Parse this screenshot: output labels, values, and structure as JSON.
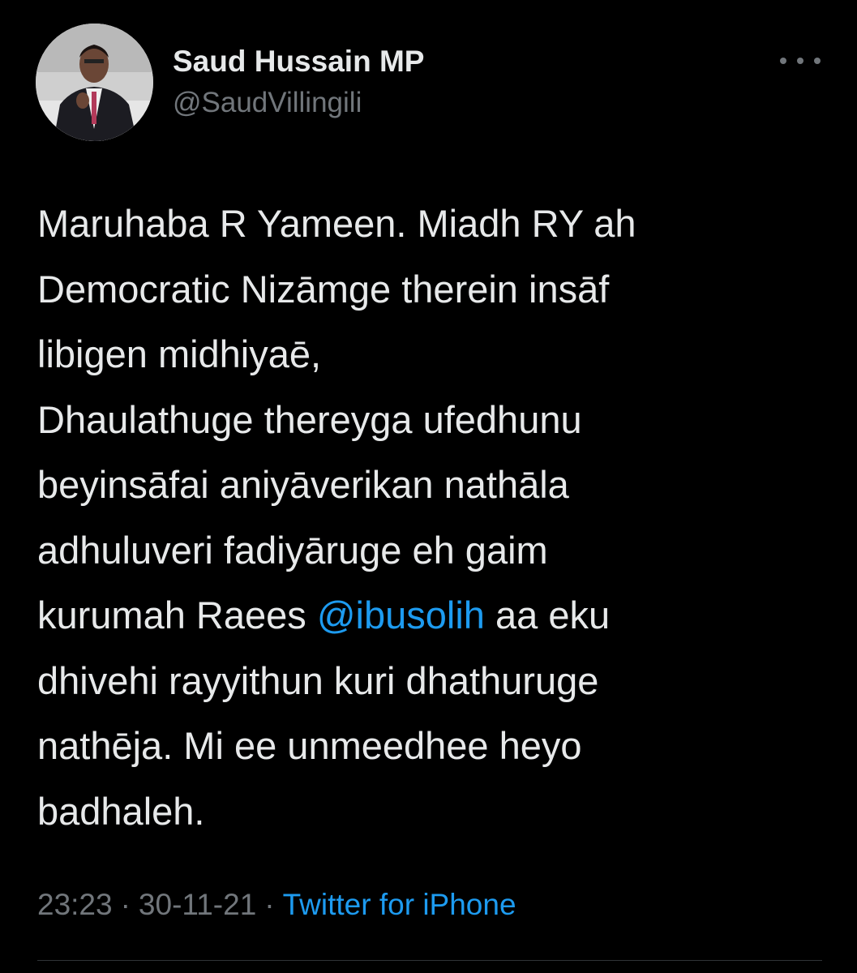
{
  "author": {
    "name": "Saud Hussain MP",
    "handle": "@SaudVillingili"
  },
  "tweet": {
    "lines": [
      {
        "text": "Maruhaba R Yameen. Miadh RY ah"
      },
      {
        "text": "Democratic Nizāmge therein insāf"
      },
      {
        "text": "libigen midhiyaē,"
      },
      {
        "text": "Dhaulathuge thereyga ufedhunu"
      },
      {
        "text": "beyinsāfai aniyāverikan nathāla"
      },
      {
        "text": "adhuluveri fadiyāruge eh gaim"
      },
      {
        "before": "kurumah Raees ",
        "mention": "@ibusolih",
        "after": " aa eku"
      },
      {
        "text": "dhivehi rayyithun kuri dhathuruge"
      },
      {
        "text": "nathēja. Mi ee unmeedhee heyo"
      },
      {
        "text": "badhaleh."
      }
    ]
  },
  "meta": {
    "time": "23:23",
    "separator": "·",
    "date": "30-11-21",
    "source": "Twitter for iPhone"
  },
  "icons": {
    "more": "more-horizontal-icon"
  },
  "colors": {
    "background": "#000000",
    "text": "#e7e9ea",
    "muted": "#71767b",
    "accent": "#1d9bf0"
  }
}
